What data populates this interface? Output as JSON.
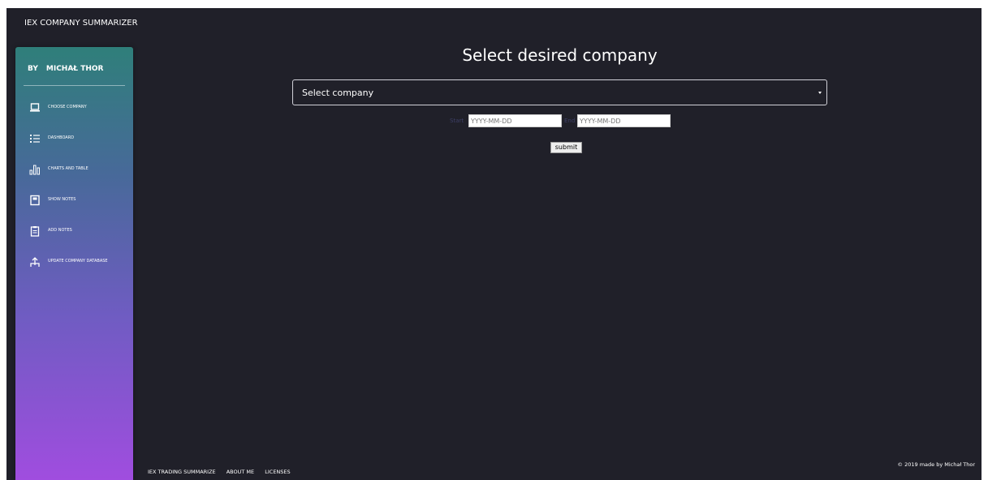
{
  "app": {
    "title": "IEX COMPANY SUMMARIZER"
  },
  "sidebar": {
    "by_label": "BY",
    "author": "MICHAŁ THOR",
    "items": [
      {
        "label": "CHOOSE COMPANY",
        "icon": "laptop-icon"
      },
      {
        "label": "DASHBOARD",
        "icon": "list-icon"
      },
      {
        "label": "CHARTS AND TABLE",
        "icon": "bar-chart-icon"
      },
      {
        "label": "SHOW NOTES",
        "icon": "notebook-icon"
      },
      {
        "label": "ADD NOTES",
        "icon": "clipboard-icon"
      },
      {
        "label": "UPDATE COMPANY DATABASE",
        "icon": "upload-icon"
      }
    ]
  },
  "main": {
    "heading": "Select desired company",
    "company_select": {
      "selected": "Select company"
    },
    "start_label": "Start",
    "start_placeholder": "YYYY-MM-DD",
    "end_label": "End",
    "end_placeholder": "YYYY-MM-DD",
    "submit_label": "submit"
  },
  "footer": {
    "links": [
      "IEX TRADING SUMMARIZE",
      "ABOUT ME",
      "LICENSES"
    ],
    "copyright": "© 2019 made by Michał Thor"
  },
  "colors": {
    "background": "#202029",
    "sidebar_top": "#2f7f7a",
    "sidebar_bottom": "#a04ddf",
    "date_label": "#3d3f66"
  }
}
